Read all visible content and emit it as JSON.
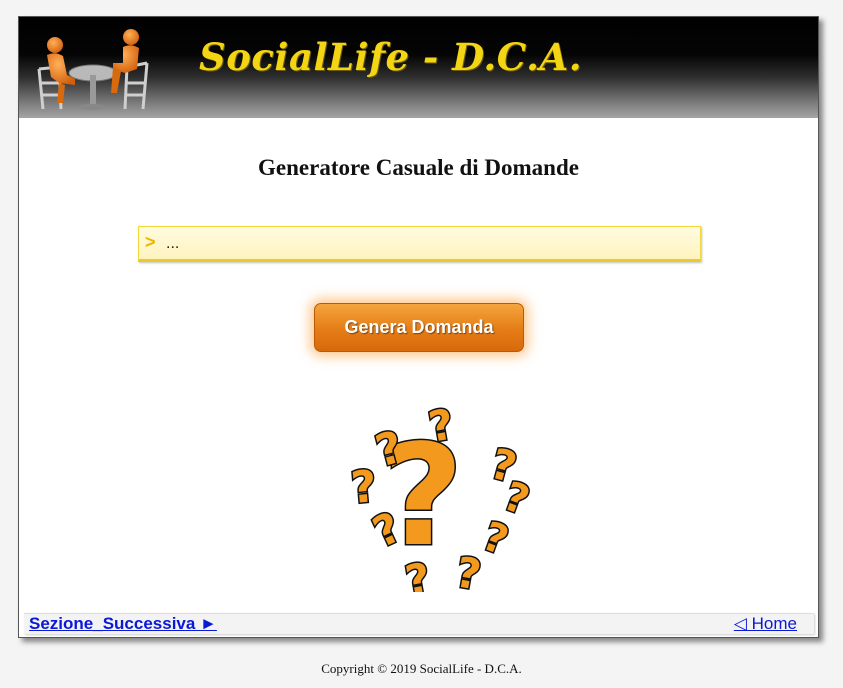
{
  "header": {
    "title": "SocialLife - D.C.A.",
    "logo_icon": "people-at-table-icon"
  },
  "main": {
    "title": "Generatore Casuale di Domande",
    "question_box": {
      "prompt_symbol": ">",
      "text": "..."
    },
    "generate_button_label": "Genera Domanda",
    "illustration_icon": "question-marks-icon"
  },
  "footer": {
    "next_section_label": "Sezione_Successiva ►",
    "home_label": "◁ Home"
  },
  "copyright": "Copyright © 2019 SocialLife - D.C.A.",
  "colors": {
    "title_yellow": "#f4d514",
    "button_orange": "#e57c16",
    "link_blue": "#0a18d8",
    "box_yellow": "#fff3c0"
  }
}
